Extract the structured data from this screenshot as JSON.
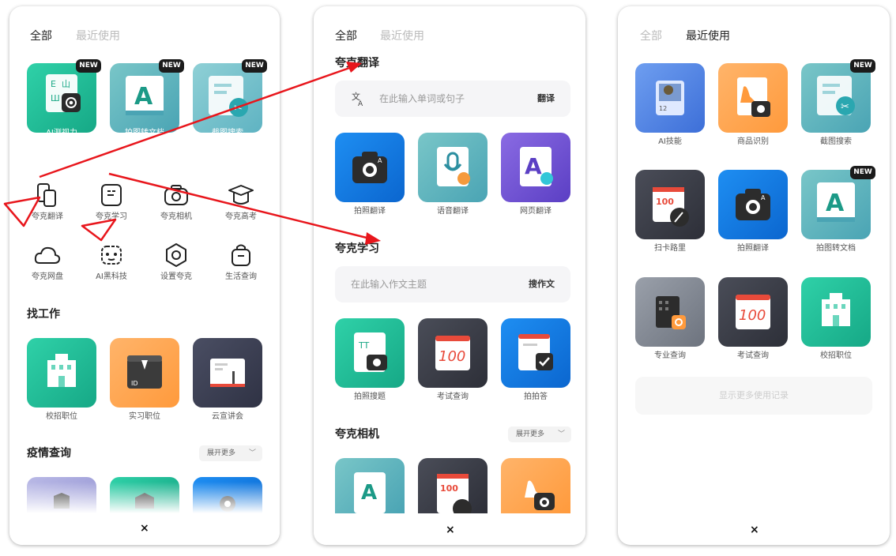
{
  "colors": {
    "annotation": "#e8161c",
    "teal": "#1fbf9a",
    "blue": "#1478e6",
    "orange": "#ff9a3c",
    "dark": "#3a3d4a",
    "purple": "#6b4fd0",
    "steel": "#5aa6c8"
  },
  "panel1": {
    "tabs": {
      "all": "全部",
      "recent": "最近使用"
    },
    "top_cards": [
      {
        "label": "AI测视力",
        "badge": "NEW",
        "icon": "eye-test-icon"
      },
      {
        "label": "拍图转文档",
        "badge": "NEW",
        "icon": "doc-a-icon"
      },
      {
        "label": "截图搜索",
        "badge": "NEW",
        "icon": "screenshot-search-icon"
      }
    ],
    "tools_row1": [
      {
        "label": "夸克翻译",
        "icon": "translate-icon"
      },
      {
        "label": "夸克学习",
        "icon": "learn-icon"
      },
      {
        "label": "夸克相机",
        "icon": "camera-icon"
      },
      {
        "label": "夸克高考",
        "icon": "graduation-cap-icon"
      }
    ],
    "tools_row2": [
      {
        "label": "夸克网盘",
        "icon": "cloud-drive-icon"
      },
      {
        "label": "AI黑科技",
        "icon": "robot-icon"
      },
      {
        "label": "设置夸克",
        "icon": "settings-icon"
      },
      {
        "label": "生活查询",
        "icon": "bag-icon"
      }
    ],
    "job_section": {
      "title": "找工作",
      "cards": [
        {
          "label": "校招职位",
          "icon": "campus-icon"
        },
        {
          "label": "实习职位",
          "icon": "resume-icon"
        },
        {
          "label": "云宣讲会",
          "icon": "presentation-icon"
        }
      ]
    },
    "epidemic_section": {
      "title": "疫情查询",
      "more": "展开更多"
    },
    "close": "×"
  },
  "panel2": {
    "tabs": {
      "all": "全部",
      "recent": "最近使用"
    },
    "translate": {
      "title": "夸克翻译",
      "placeholder": "在此输入单词或句子",
      "action": "翻译",
      "cards": [
        {
          "label": "拍照翻译",
          "icon": "camera-translate-icon"
        },
        {
          "label": "语音翻译",
          "icon": "voice-translate-icon"
        },
        {
          "label": "网页翻译",
          "icon": "web-translate-icon"
        }
      ]
    },
    "learn": {
      "title": "夸克学习",
      "placeholder": "在此输入作文主题",
      "action": "搜作文",
      "cards": [
        {
          "label": "拍照搜题",
          "icon": "photo-search-question-icon"
        },
        {
          "label": "考试查询",
          "icon": "exam-query-icon"
        },
        {
          "label": "拍拍答",
          "icon": "check-answer-icon"
        }
      ]
    },
    "camera": {
      "title": "夸克相机",
      "more": "展开更多"
    },
    "close": "×"
  },
  "panel3": {
    "tabs": {
      "all": "全部",
      "recent": "最近使用"
    },
    "cards": [
      {
        "label": "AI技能",
        "icon": "ai-skill-icon",
        "badge": ""
      },
      {
        "label": "商品识别",
        "icon": "product-recognition-icon",
        "badge": ""
      },
      {
        "label": "截图搜索",
        "icon": "screenshot-search-icon",
        "badge": "NEW"
      },
      {
        "label": "扫卡路里",
        "icon": "calorie-icon",
        "badge": ""
      },
      {
        "label": "拍照翻译",
        "icon": "camera-translate-icon",
        "badge": ""
      },
      {
        "label": "拍图转文档",
        "icon": "doc-a-icon",
        "badge": "NEW"
      },
      {
        "label": "专业查询",
        "icon": "major-query-icon",
        "badge": ""
      },
      {
        "label": "考试查询",
        "icon": "exam-query-icon",
        "badge": ""
      },
      {
        "label": "校招职位",
        "icon": "campus-icon",
        "badge": ""
      }
    ],
    "show_more": "显示更多使用记录",
    "close": "×"
  }
}
